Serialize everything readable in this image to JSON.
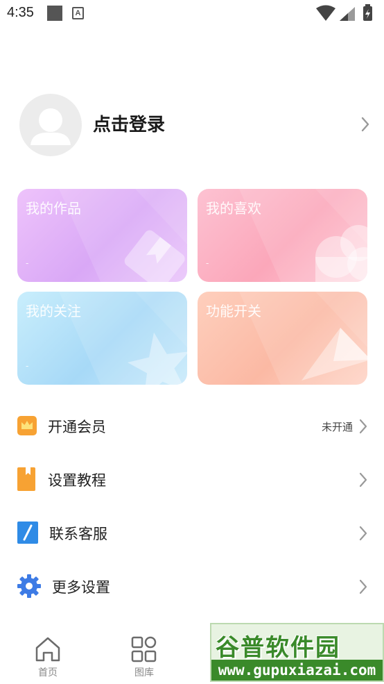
{
  "status_bar": {
    "time": "4:35",
    "notification_icons": [
      "stop-square-icon",
      "a-letter-icon"
    ],
    "system_icons": [
      "wifi-icon",
      "signal-icon",
      "battery-charging-icon"
    ]
  },
  "profile": {
    "login_label": "点击登录",
    "avatar_icon": "default-avatar-icon",
    "chevron_icon": "chevron-right-icon"
  },
  "cards": [
    {
      "title": "我的作品",
      "subtitle": "-",
      "icon": "bookmark-icon",
      "gradient": [
        "#eec3fb",
        "#d9a8f6"
      ]
    },
    {
      "title": "我的喜欢",
      "subtitle": "-",
      "icon": "cloud-icon",
      "gradient": [
        "#fdc2d2",
        "#fba7ba"
      ]
    },
    {
      "title": "我的关注",
      "subtitle": "-",
      "icon": "star-icon",
      "gradient": [
        "#c9eefc",
        "#a7d9f7"
      ]
    },
    {
      "title": "功能开关",
      "subtitle": "",
      "icon": "send-icon",
      "gradient": [
        "#fecfbd",
        "#fbb9a4"
      ]
    }
  ],
  "menu": [
    {
      "label": "开通会员",
      "status": "未开通",
      "icon": "crown-icon",
      "icon_color": "#f7a233"
    },
    {
      "label": "设置教程",
      "status": "",
      "icon": "book-icon",
      "icon_color": "#f7a233"
    },
    {
      "label": "联系客服",
      "status": "",
      "icon": "pen-icon",
      "icon_color": "#2f8be6"
    },
    {
      "label": "更多设置",
      "status": "",
      "icon": "gear-icon",
      "icon_color": "#3d7be5"
    }
  ],
  "bottom_nav": [
    {
      "label": "首页",
      "icon": "home-icon"
    },
    {
      "label": "图库",
      "icon": "grid-icon"
    }
  ],
  "watermark": {
    "title": "谷普软件园",
    "url": "www.gupuxiazai.com"
  }
}
